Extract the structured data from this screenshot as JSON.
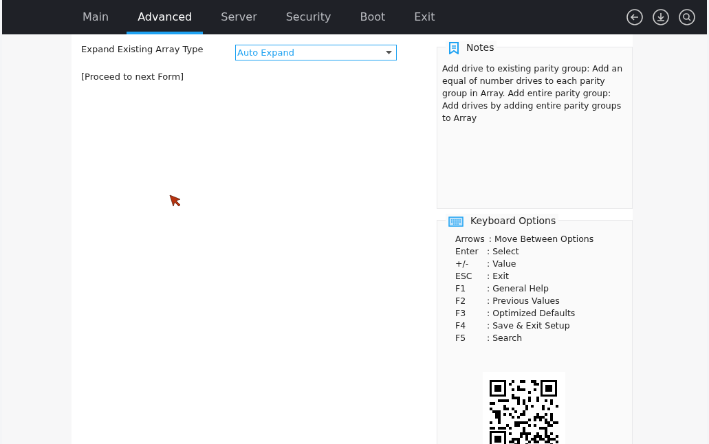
{
  "tabs": [
    {
      "label": "Main",
      "selected": false
    },
    {
      "label": "Advanced",
      "selected": true
    },
    {
      "label": "Server",
      "selected": false
    },
    {
      "label": "Security",
      "selected": false
    },
    {
      "label": "Boot",
      "selected": false
    },
    {
      "label": "Exit",
      "selected": false
    }
  ],
  "form": {
    "fields": [
      {
        "kind": "dropdown",
        "label": "Expand Existing Array Type",
        "value": "Auto Expand"
      },
      {
        "kind": "link",
        "label": "[Proceed to next Form]"
      }
    ]
  },
  "notes": {
    "title": "Notes",
    "text": "Add drive to existing parity group: Add an equal of number drives to each parity group in Array. Add entire parity group: Add drives by adding entire parity groups to Array"
  },
  "keyboard_options": {
    "title": "Keyboard Options",
    "items": [
      {
        "key": "Arrows",
        "action": ": Move Between Options"
      },
      {
        "key": "Enter",
        "action": ": Select"
      },
      {
        "key": "+/-",
        "action": ": Value"
      },
      {
        "key": "ESC",
        "action": ": Exit"
      },
      {
        "key": "F1",
        "action": ": General Help"
      },
      {
        "key": "F2",
        "action": ": Previous Values"
      },
      {
        "key": "F3",
        "action": ": Optimized Defaults"
      },
      {
        "key": "F4",
        "action": ": Save & Exit Setup"
      },
      {
        "key": "F5",
        "action": ": Search"
      }
    ]
  }
}
